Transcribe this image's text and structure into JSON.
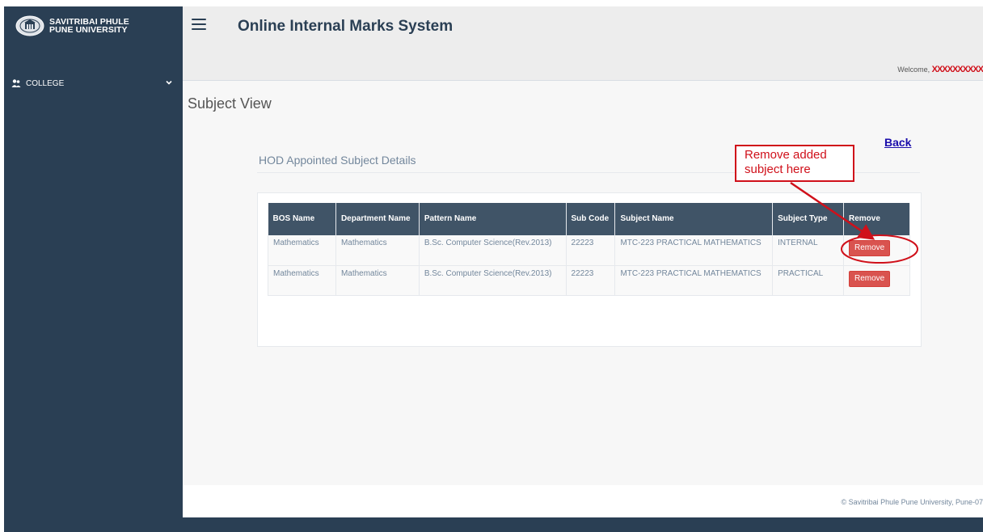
{
  "sidebar": {
    "brand_line1": "SAVITRIBAI PHULE",
    "brand_line2": "PUNE UNIVERSITY",
    "college_label": "COLLEGE",
    "icons": {
      "logo": "university-seal-icon",
      "college": "users-icon",
      "chevron": "chevron-down-icon"
    }
  },
  "header": {
    "menu_icon": "hamburger-icon",
    "title": "Online Internal Marks System",
    "welcome_prefix": "Welcome,",
    "username": "XXXXXXXXXX"
  },
  "main": {
    "page_title": "Subject View",
    "back_label": "Back",
    "panel_title": "HOD Appointed Subject Details",
    "table": {
      "headers": [
        "BOS Name",
        "Department Name",
        "Pattern Name",
        "Sub Code",
        "Subject Name",
        "Subject Type",
        "Remove"
      ],
      "rows": [
        {
          "bos": "Mathematics",
          "dept": "Mathematics",
          "pattern": "B.Sc. Computer Science(Rev.2013)",
          "code": "22223",
          "subject": "MTC-223 PRACTICAL MATHEMATICS",
          "type": "INTERNAL",
          "action": "Remove"
        },
        {
          "bos": "Mathematics",
          "dept": "Mathematics",
          "pattern": "B.Sc. Computer Science(Rev.2013)",
          "code": "22223",
          "subject": "MTC-223 PRACTICAL MATHEMATICS",
          "type": "PRACTICAL",
          "action": "Remove"
        }
      ]
    }
  },
  "annotation": {
    "callout_line1": "Remove added",
    "callout_line2": "subject here",
    "color": "#d0101a"
  },
  "footer": {
    "text": "© Savitribai Phule Pune University, Pune-07"
  },
  "colors": {
    "sidebar_bg": "#2a3f54",
    "table_header_bg": "#405467",
    "danger": "#d9534f",
    "link": "#1a0dab"
  }
}
